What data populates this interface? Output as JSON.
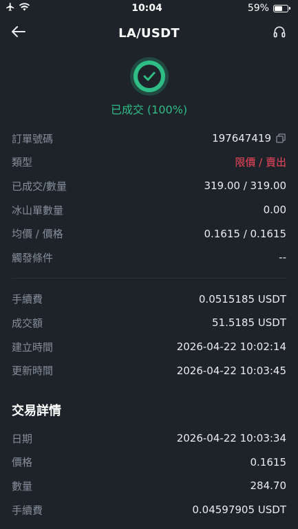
{
  "status_bar": {
    "time": "10:04",
    "battery": "59%",
    "battery_level": 0.59
  },
  "nav": {
    "title": "LA/USDT"
  },
  "order_status": {
    "text": "已成交 (100%)"
  },
  "details": [
    {
      "label": "訂單號碼",
      "value": "197647419",
      "copy": true
    },
    {
      "label": "類型",
      "value": "限價 / 賣出",
      "red": true
    },
    {
      "label": "已成交/數量",
      "value": "319.00 / 319.00"
    },
    {
      "label": "冰山單數量",
      "value": "0.00"
    },
    {
      "label": "均價 / 價格",
      "value": "0.1615 / 0.1615"
    },
    {
      "label": "觸發條件",
      "value": "--"
    }
  ],
  "fees": [
    {
      "label": "手續費",
      "value": "0.0515185 USDT"
    },
    {
      "label": "成交額",
      "value": "51.5185 USDT"
    },
    {
      "label": "建立時間",
      "value": "2026-04-22 10:02:14"
    },
    {
      "label": "更新時間",
      "value": "2026-04-22 10:03:45"
    }
  ],
  "trade_section": {
    "title": "交易詳情",
    "rows": [
      {
        "label": "日期",
        "value": "2026-04-22 10:03:34"
      },
      {
        "label": "價格",
        "value": "0.1615"
      },
      {
        "label": "數量",
        "value": "284.70"
      },
      {
        "label": "手續費",
        "value": "0.04597905 USDT"
      }
    ]
  },
  "colors": {
    "background": "#1e2329",
    "success": "#2ebd85",
    "sell": "#f6465d",
    "label": "#848e9c"
  }
}
